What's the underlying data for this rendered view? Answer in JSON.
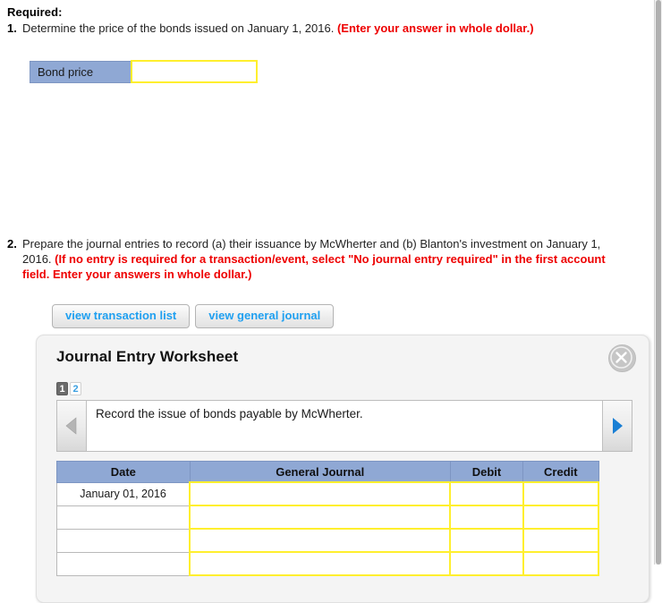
{
  "page": {
    "required_heading": "Required:"
  },
  "question1": {
    "number": "1.",
    "text": "Determine the price of the bonds issued on January 1, 2016. ",
    "note": "(Enter your answer in whole dollar.)",
    "bond_price_label": "Bond price",
    "bond_price_value": ""
  },
  "question2": {
    "number": "2.",
    "text": "Prepare the journal entries to record (a) their issuance by McWherter and (b) Blanton's investment on January 1, 2016. ",
    "note": "(If no entry is required for a transaction/event, select \"No journal entry required\" in the first account field. Enter your answers in whole dollar.)",
    "buttons": {
      "transaction_list": "view transaction list",
      "general_journal": "view general journal"
    }
  },
  "worksheet": {
    "title": "Journal Entry Worksheet",
    "close_label": "X",
    "tabs": [
      {
        "label": "1",
        "active": true
      },
      {
        "label": "2",
        "active": false
      }
    ],
    "prev_label": "Previous entry",
    "next_label": "Next entry",
    "description": "Record the issue of bonds payable by McWherter.",
    "table": {
      "headers": [
        "Date",
        "General Journal",
        "Debit",
        "Credit"
      ],
      "rows": [
        {
          "date": "January 01, 2016",
          "account": "",
          "debit": "",
          "credit": ""
        },
        {
          "date": "",
          "account": "",
          "debit": "",
          "credit": ""
        },
        {
          "date": "",
          "account": "",
          "debit": "",
          "credit": ""
        },
        {
          "date": "",
          "account": "",
          "debit": "",
          "credit": ""
        }
      ]
    }
  },
  "colors": {
    "header_blue": "#8fa8d4",
    "input_yellow": "#ffef2e",
    "note_red": "#ee0000",
    "link_blue": "#20a0f0",
    "arrow_blue": "#1a7fd4"
  }
}
